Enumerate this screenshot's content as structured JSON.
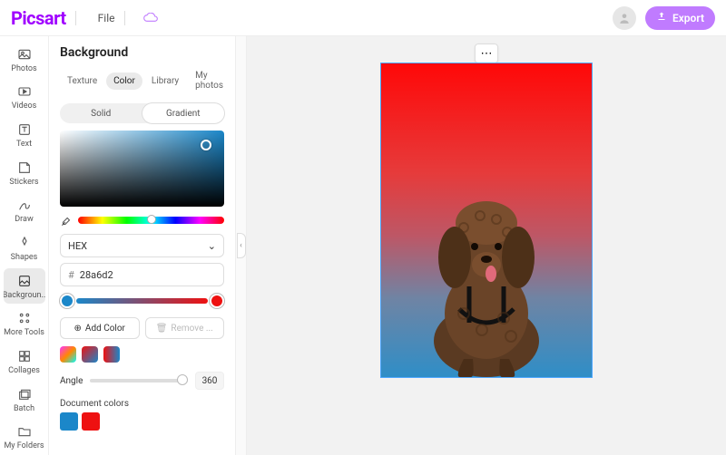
{
  "topbar": {
    "logo": "Picsart",
    "file_label": "File",
    "export_label": "Export"
  },
  "rail": {
    "items": [
      {
        "id": "photos",
        "label": "Photos"
      },
      {
        "id": "videos",
        "label": "Videos"
      },
      {
        "id": "text",
        "label": "Text"
      },
      {
        "id": "stickers",
        "label": "Stickers"
      },
      {
        "id": "draw",
        "label": "Draw"
      },
      {
        "id": "shapes",
        "label": "Shapes"
      },
      {
        "id": "background",
        "label": "Backgroun..",
        "active": true
      },
      {
        "id": "more-tools",
        "label": "More Tools"
      },
      {
        "id": "collages",
        "label": "Collages"
      },
      {
        "id": "batch",
        "label": "Batch"
      },
      {
        "id": "my-folders",
        "label": "My Folders"
      }
    ]
  },
  "panel": {
    "title": "Background",
    "tabs": [
      "Texture",
      "Color",
      "Library",
      "My photos"
    ],
    "active_tab": "Color",
    "fill_toggle": {
      "options": [
        "Solid",
        "Gradient"
      ],
      "active": "Gradient"
    },
    "color_format": "HEX",
    "hex_prefix": "#",
    "hex_value": "28a6d2",
    "gradient_stops": [
      {
        "color": "#1b87c9"
      },
      {
        "color": "#ee1111"
      }
    ],
    "add_color_label": "Add Color",
    "remove_label": "Remove ...",
    "preset_swatches": [
      "linear-gradient(135deg,#ff3,#f0f,#0ff)",
      "linear-gradient(135deg,#e11,#1b87c9)",
      "linear-gradient(90deg,#e11,#1b87c9)"
    ],
    "angle_label": "Angle",
    "angle_value": "360",
    "doc_colors_label": "Document colors",
    "doc_colors": [
      "#1b87c9",
      "#ee1111"
    ]
  },
  "canvas": {
    "more_menu": "⋯"
  }
}
